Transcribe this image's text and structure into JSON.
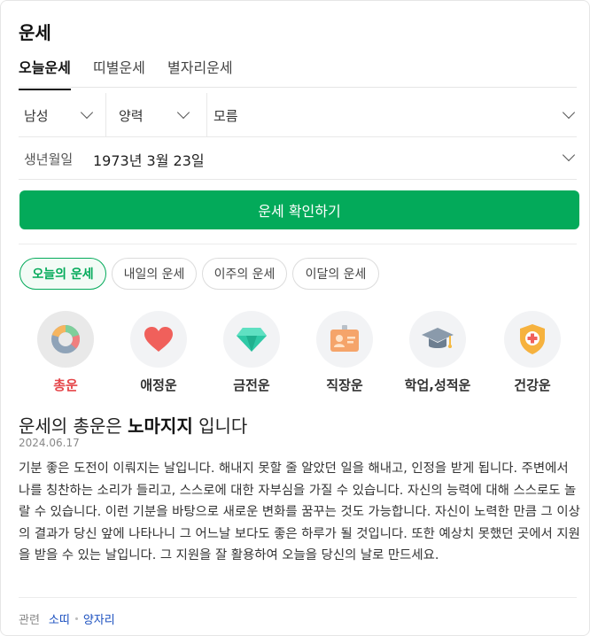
{
  "title": "운세",
  "tabs": [
    {
      "label": "오늘운세",
      "active": true
    },
    {
      "label": "띠별운세",
      "active": false
    },
    {
      "label": "별자리운세",
      "active": false
    }
  ],
  "filters": {
    "gender": "남성",
    "calendar": "양력",
    "birth_time": "모름"
  },
  "birth": {
    "label": "생년월일",
    "value": "1973년 3월 23일"
  },
  "cta_label": "운세 확인하기",
  "periods": [
    {
      "label": "오늘의 운세",
      "active": true
    },
    {
      "label": "내일의 운세",
      "active": false
    },
    {
      "label": "이주의 운세",
      "active": false
    },
    {
      "label": "이달의 운세",
      "active": false
    }
  ],
  "categories": [
    {
      "label": "총운",
      "icon": "donut-chart-icon",
      "active": true
    },
    {
      "label": "애정운",
      "icon": "heart-icon",
      "active": false
    },
    {
      "label": "금전운",
      "icon": "diamond-icon",
      "active": false
    },
    {
      "label": "직장운",
      "icon": "id-badge-icon",
      "active": false
    },
    {
      "label": "학업,성적운",
      "icon": "graduation-cap-icon",
      "active": false
    },
    {
      "label": "건강운",
      "icon": "health-shield-icon",
      "active": false
    }
  ],
  "result": {
    "prefix": "운세의 총운은",
    "keyword": "노마지지",
    "suffix": "입니다",
    "date": "2024.06.17",
    "text": "기분 좋은 도전이 이뤄지는 날입니다. 해내지 못할 줄 알았던 일을 해내고, 인정을 받게 됩니다. 주변에서 나를 칭찬하는 소리가 들리고, 스스로에 대한 자부심을 가질 수 있습니다. 자신의 능력에 대해 스스로도 놀랄 수 있습니다. 이런 기분을 바탕으로 새로운 변화를 꿈꾸는 것도 가능합니다. 자신이 노력한 만큼 그 이상의 결과가 당신 앞에 나타나니 그 어느날 보다도 좋은 하루가 될 것입니다. 또한 예상치 못했던 곳에서 지원을 받을 수 있는 날입니다. 그 지원을 잘 활용하여 오늘을 당신의 날로 만드세요."
  },
  "related": {
    "label": "관련",
    "links": [
      "소띠",
      "양자리"
    ]
  },
  "colors": {
    "accent_green": "#03aa5a",
    "active_category_red": "#e5464a",
    "link_blue": "#1a4fbf"
  }
}
